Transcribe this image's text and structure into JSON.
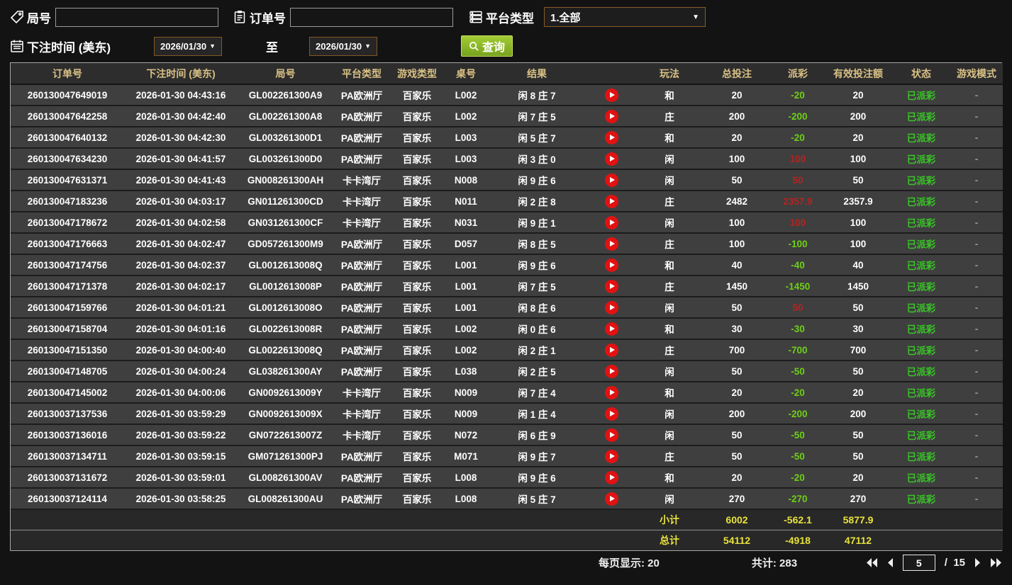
{
  "filters": {
    "round_label": "局号",
    "order_label": "订单号",
    "platform_label": "平台类型",
    "platform_value": "1.全部",
    "time_label": "下注时间 (美东)",
    "to_label": "至",
    "date_from": "2026/01/30",
    "date_to": "2026/01/30",
    "search_label": "查询"
  },
  "table": {
    "headers": [
      "订单号",
      "下注时间 (美东)",
      "局号",
      "平台类型",
      "游戏类型",
      "桌号",
      "结果",
      "",
      "玩法",
      "总投注",
      "派彩",
      "有效投注额",
      "状态",
      "游戏模式"
    ],
    "rows": [
      {
        "order": "260130047649019",
        "time": "2026-01-30 04:43:16",
        "round": "GL002261300A9",
        "platform": "PA欧洲厅",
        "game": "百家乐",
        "table": "L002",
        "result": "闲 8 庄 7",
        "play": "和",
        "bet": "20",
        "payout": "-20",
        "valid": "20",
        "status": "已派彩",
        "mode": "-"
      },
      {
        "order": "260130047642258",
        "time": "2026-01-30 04:42:40",
        "round": "GL002261300A8",
        "platform": "PA欧洲厅",
        "game": "百家乐",
        "table": "L002",
        "result": "闲 7 庄 5",
        "play": "庄",
        "bet": "200",
        "payout": "-200",
        "valid": "200",
        "status": "已派彩",
        "mode": "-"
      },
      {
        "order": "260130047640132",
        "time": "2026-01-30 04:42:30",
        "round": "GL003261300D1",
        "platform": "PA欧洲厅",
        "game": "百家乐",
        "table": "L003",
        "result": "闲 5 庄 7",
        "play": "和",
        "bet": "20",
        "payout": "-20",
        "valid": "20",
        "status": "已派彩",
        "mode": "-"
      },
      {
        "order": "260130047634230",
        "time": "2026-01-30 04:41:57",
        "round": "GL003261300D0",
        "platform": "PA欧洲厅",
        "game": "百家乐",
        "table": "L003",
        "result": "闲 3 庄 0",
        "play": "闲",
        "bet": "100",
        "payout": "100",
        "valid": "100",
        "status": "已派彩",
        "mode": "-"
      },
      {
        "order": "260130047631371",
        "time": "2026-01-30 04:41:43",
        "round": "GN008261300AH",
        "platform": "卡卡湾厅",
        "game": "百家乐",
        "table": "N008",
        "result": "闲 9 庄 6",
        "play": "闲",
        "bet": "50",
        "payout": "50",
        "valid": "50",
        "status": "已派彩",
        "mode": "-"
      },
      {
        "order": "260130047183236",
        "time": "2026-01-30 04:03:17",
        "round": "GN011261300CD",
        "platform": "卡卡湾厅",
        "game": "百家乐",
        "table": "N011",
        "result": "闲 2 庄 8",
        "play": "庄",
        "bet": "2482",
        "payout": "2357.9",
        "valid": "2357.9",
        "status": "已派彩",
        "mode": "-"
      },
      {
        "order": "260130047178672",
        "time": "2026-01-30 04:02:58",
        "round": "GN031261300CF",
        "platform": "卡卡湾厅",
        "game": "百家乐",
        "table": "N031",
        "result": "闲 9 庄 1",
        "play": "闲",
        "bet": "100",
        "payout": "100",
        "valid": "100",
        "status": "已派彩",
        "mode": "-"
      },
      {
        "order": "260130047176663",
        "time": "2026-01-30 04:02:47",
        "round": "GD057261300M9",
        "platform": "PA欧洲厅",
        "game": "百家乐",
        "table": "D057",
        "result": "闲 8 庄 5",
        "play": "庄",
        "bet": "100",
        "payout": "-100",
        "valid": "100",
        "status": "已派彩",
        "mode": "-"
      },
      {
        "order": "260130047174756",
        "time": "2026-01-30 04:02:37",
        "round": "GL0012613008Q",
        "platform": "PA欧洲厅",
        "game": "百家乐",
        "table": "L001",
        "result": "闲 9 庄 6",
        "play": "和",
        "bet": "40",
        "payout": "-40",
        "valid": "40",
        "status": "已派彩",
        "mode": "-"
      },
      {
        "order": "260130047171378",
        "time": "2026-01-30 04:02:17",
        "round": "GL0012613008P",
        "platform": "PA欧洲厅",
        "game": "百家乐",
        "table": "L001",
        "result": "闲 7 庄 5",
        "play": "庄",
        "bet": "1450",
        "payout": "-1450",
        "valid": "1450",
        "status": "已派彩",
        "mode": "-"
      },
      {
        "order": "260130047159766",
        "time": "2026-01-30 04:01:21",
        "round": "GL0012613008O",
        "platform": "PA欧洲厅",
        "game": "百家乐",
        "table": "L001",
        "result": "闲 8 庄 6",
        "play": "闲",
        "bet": "50",
        "payout": "50",
        "valid": "50",
        "status": "已派彩",
        "mode": "-"
      },
      {
        "order": "260130047158704",
        "time": "2026-01-30 04:01:16",
        "round": "GL0022613008R",
        "platform": "PA欧洲厅",
        "game": "百家乐",
        "table": "L002",
        "result": "闲 0 庄 6",
        "play": "和",
        "bet": "30",
        "payout": "-30",
        "valid": "30",
        "status": "已派彩",
        "mode": "-"
      },
      {
        "order": "260130047151350",
        "time": "2026-01-30 04:00:40",
        "round": "GL0022613008Q",
        "platform": "PA欧洲厅",
        "game": "百家乐",
        "table": "L002",
        "result": "闲 2 庄 1",
        "play": "庄",
        "bet": "700",
        "payout": "-700",
        "valid": "700",
        "status": "已派彩",
        "mode": "-"
      },
      {
        "order": "260130047148705",
        "time": "2026-01-30 04:00:24",
        "round": "GL038261300AY",
        "platform": "PA欧洲厅",
        "game": "百家乐",
        "table": "L038",
        "result": "闲 2 庄 5",
        "play": "闲",
        "bet": "50",
        "payout": "-50",
        "valid": "50",
        "status": "已派彩",
        "mode": "-"
      },
      {
        "order": "260130047145002",
        "time": "2026-01-30 04:00:06",
        "round": "GN0092613009Y",
        "platform": "卡卡湾厅",
        "game": "百家乐",
        "table": "N009",
        "result": "闲 7 庄 4",
        "play": "和",
        "bet": "20",
        "payout": "-20",
        "valid": "20",
        "status": "已派彩",
        "mode": "-"
      },
      {
        "order": "260130037137536",
        "time": "2026-01-30 03:59:29",
        "round": "GN0092613009X",
        "platform": "卡卡湾厅",
        "game": "百家乐",
        "table": "N009",
        "result": "闲 1 庄 4",
        "play": "闲",
        "bet": "200",
        "payout": "-200",
        "valid": "200",
        "status": "已派彩",
        "mode": "-"
      },
      {
        "order": "260130037136016",
        "time": "2026-01-30 03:59:22",
        "round": "GN0722613007Z",
        "platform": "卡卡湾厅",
        "game": "百家乐",
        "table": "N072",
        "result": "闲 6 庄 9",
        "play": "闲",
        "bet": "50",
        "payout": "-50",
        "valid": "50",
        "status": "已派彩",
        "mode": "-"
      },
      {
        "order": "260130037134711",
        "time": "2026-01-30 03:59:15",
        "round": "GM071261300PJ",
        "platform": "PA欧洲厅",
        "game": "百家乐",
        "table": "M071",
        "result": "闲 9 庄 7",
        "play": "庄",
        "bet": "50",
        "payout": "-50",
        "valid": "50",
        "status": "已派彩",
        "mode": "-"
      },
      {
        "order": "260130037131672",
        "time": "2026-01-30 03:59:01",
        "round": "GL008261300AV",
        "platform": "PA欧洲厅",
        "game": "百家乐",
        "table": "L008",
        "result": "闲 9 庄 6",
        "play": "和",
        "bet": "20",
        "payout": "-20",
        "valid": "20",
        "status": "已派彩",
        "mode": "-"
      },
      {
        "order": "260130037124114",
        "time": "2026-01-30 03:58:25",
        "round": "GL008261300AU",
        "platform": "PA欧洲厅",
        "game": "百家乐",
        "table": "L008",
        "result": "闲 5 庄 7",
        "play": "闲",
        "bet": "270",
        "payout": "-270",
        "valid": "270",
        "status": "已派彩",
        "mode": "-"
      }
    ],
    "subtotal": {
      "label": "小计",
      "total_bet": "6002",
      "payout": "-562.1",
      "valid_bet": "5877.9"
    },
    "total": {
      "label": "总计",
      "total_bet": "54112",
      "payout": "-4918",
      "valid_bet": "47112"
    }
  },
  "footer": {
    "page_size_label": "每页显示:",
    "page_size_value": "20",
    "total_count_label": "共计:",
    "total_count_value": "283",
    "current_page": "5",
    "page_separator": "/",
    "total_pages": "15"
  },
  "colors": {
    "header_text": "#d9c185",
    "payout_negative": "#6ecf16",
    "payout_positive": "#b32421",
    "status_green": "#39c527",
    "summary_yellow": "#e8e33b",
    "search_button_green": "#8db827",
    "date_border_brown": "#86571e",
    "play_icon_red": "#e21212"
  }
}
